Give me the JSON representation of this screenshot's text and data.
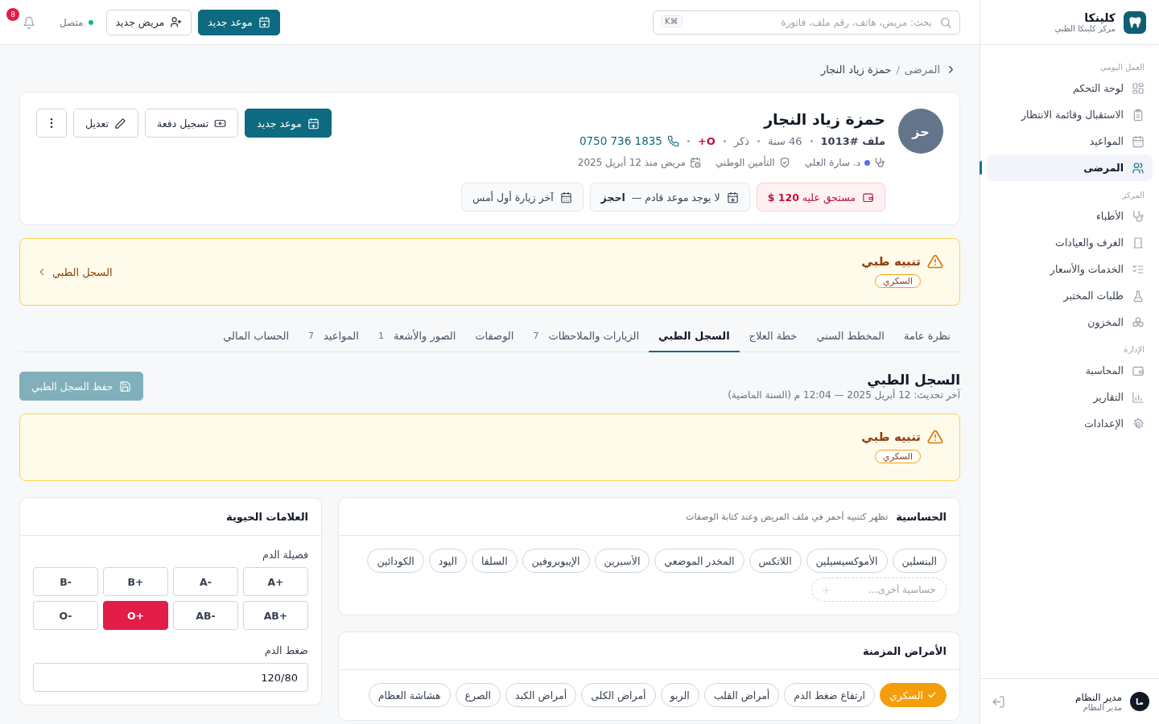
{
  "sidebar": {
    "brand": {
      "name": "كلينكا",
      "subtitle": "مركز كلينكا الطبي"
    },
    "groups": [
      {
        "title": "العمل اليومي",
        "items": [
          {
            "label": "لوحة التحكم",
            "selected": false
          },
          {
            "label": "الاستقبال وقائمة الانتظار",
            "selected": false
          },
          {
            "label": "المواعيد",
            "selected": false
          },
          {
            "label": "المرضى",
            "selected": true
          }
        ]
      },
      {
        "title": "المركز",
        "items": [
          {
            "label": "الأطباء",
            "selected": false
          },
          {
            "label": "الغرف والعيادات",
            "selected": false
          },
          {
            "label": "الخدمات والأسعار",
            "selected": false
          },
          {
            "label": "طلبات المختبر",
            "selected": false
          },
          {
            "label": "المخزون",
            "selected": false
          }
        ]
      },
      {
        "title": "الإدارة",
        "items": [
          {
            "label": "المحاسبة",
            "selected": false
          },
          {
            "label": "التقارير",
            "selected": false
          },
          {
            "label": "الإعدادات",
            "selected": false
          }
        ]
      }
    ],
    "user": {
      "initials": "ما",
      "name": "مدير النظام",
      "role": "مدير النظام"
    }
  },
  "topbar": {
    "search": {
      "placeholder": "بحث: مريض، هاتف، رقم ملف، فاتورة",
      "shortcut": "⌘K"
    },
    "new_appointment": "موعد جديد",
    "new_patient": "مريض جديد",
    "status": {
      "label": "متصل",
      "online": true
    },
    "notifications": {
      "count": "8"
    }
  },
  "breadcrumb": {
    "parent": "المرضى",
    "separator": "/",
    "current": "حمزة زياد النجار"
  },
  "patient": {
    "initials": "حز",
    "name": "حمزة زياد النجار",
    "file": "ملف #1013",
    "age": "46 سنة",
    "gender": "ذكر",
    "blood": "O+",
    "phone": "0750 736 1835",
    "doctor": "د. سارة العلي",
    "insurance": "التأمين الوطني",
    "since": "مريض منذ 12 أبريل 2025",
    "chips": [
      {
        "kind": "balance",
        "label": "مستحق عليه",
        "amount": "120 $"
      },
      {
        "kind": "next",
        "text": "لا يوجد موعد قادم —",
        "action": "احجز"
      },
      {
        "kind": "last",
        "text": "آخر زيارة أول أمس"
      }
    ],
    "actions": [
      "موعد جديد",
      "تسجيل دفعة",
      "تعديل"
    ]
  },
  "top_alert": {
    "title": "تنبيه طبي",
    "tags": [
      "السكري"
    ],
    "link": "السجل الطبي"
  },
  "tabs": [
    {
      "label": "نظرة عامة",
      "selected": false
    },
    {
      "label": "المخطط السني",
      "selected": false
    },
    {
      "label": "خطة العلاج",
      "selected": false
    },
    {
      "label": "السجل الطبي",
      "selected": true
    },
    {
      "label": "الزيارات والملاحظات",
      "count": "7",
      "selected": false
    },
    {
      "label": "الوصفات",
      "selected": false
    },
    {
      "label": "الصور والأشعة",
      "count": "1",
      "selected": false
    },
    {
      "label": "المواعيد",
      "count": "7",
      "selected": false
    },
    {
      "label": "الحساب المالي",
      "selected": false
    }
  ],
  "section": {
    "title": "السجل الطبي",
    "updated": "آخر تحديث: 12 أبريل 2025 — 12:04 م (السنة الماضية)",
    "save": {
      "label": "حفظ السجل الطبي",
      "disabled": true
    }
  },
  "record_alert": {
    "title": "تنبيه طبي",
    "tags": [
      "السكري"
    ]
  },
  "allergies": {
    "title": "الحساسية",
    "hint": "تظهر كتنبيه أحمر في ملف المريض وعند كتابة الوصفات",
    "items": [
      "البنسلين",
      "الأموكسيسيلين",
      "اللاتكس",
      "المخدر الموضعي",
      "الأسبرين",
      "الإيبوبروفين",
      "السلفا",
      "اليود",
      "الكودائين"
    ],
    "add_placeholder": "حساسية أخرى..."
  },
  "vitals": {
    "title": "العلامات الحيوية",
    "blood_label": "فصيلة الدم",
    "blood_types": [
      {
        "label": "A+",
        "selected": false
      },
      {
        "label": "A-",
        "selected": false
      },
      {
        "label": "B+",
        "selected": false
      },
      {
        "label": "B-",
        "selected": false
      },
      {
        "label": "AB+",
        "selected": false
      },
      {
        "label": "AB-",
        "selected": false
      },
      {
        "label": "O+",
        "selected": true
      },
      {
        "label": "O-",
        "selected": false
      }
    ],
    "bp_label": "ضغط الدم",
    "bp_value": "120/80"
  },
  "chronic": {
    "title": "الأمراض المزمنة",
    "items": [
      {
        "label": "السكري",
        "selected": true
      },
      {
        "label": "ارتفاع ضغط الدم",
        "selected": false
      },
      {
        "label": "أمراض القلب",
        "selected": false
      },
      {
        "label": "الربو",
        "selected": false
      },
      {
        "label": "أمراض الكلى",
        "selected": false
      },
      {
        "label": "أمراض الكبد",
        "selected": false
      },
      {
        "label": "الصرع",
        "selected": false
      },
      {
        "label": "هشاشة العظام",
        "selected": false
      }
    ]
  }
}
